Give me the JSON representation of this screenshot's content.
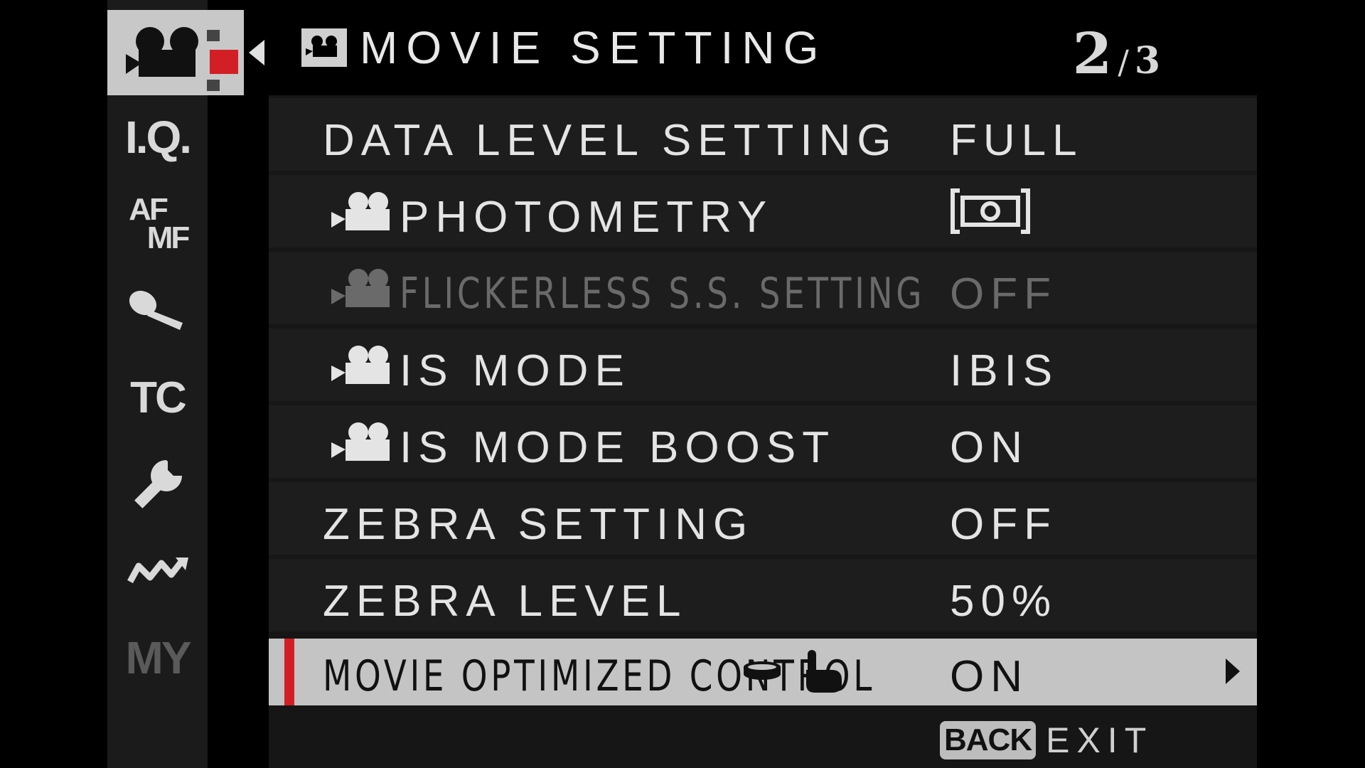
{
  "sidebar": {
    "items": [
      {
        "name": "movie-tab",
        "label": ""
      },
      {
        "name": "image-quality",
        "label": "I.Q."
      },
      {
        "name": "af-mf",
        "label_top": "AF",
        "label_bottom": "MF"
      },
      {
        "name": "audio",
        "icon": "microphone-icon"
      },
      {
        "name": "timecode",
        "label": "TC"
      },
      {
        "name": "setup",
        "icon": "wrench-icon"
      },
      {
        "name": "connection",
        "icon": "wave-arrow-icon"
      },
      {
        "name": "my-menu",
        "label": "MY"
      }
    ]
  },
  "header": {
    "title": "MOVIE SETTING",
    "icon": "movie-camera-icon",
    "page_current": "2",
    "page_separator": "/",
    "page_total": "3"
  },
  "menu": {
    "rows": [
      {
        "label": "DATA LEVEL SETTING",
        "value": "FULL",
        "has_movie_icon": false,
        "enabled": true
      },
      {
        "label": "PHOTOMETRY",
        "value_icon": "photometry-multi-icon",
        "has_movie_icon": true,
        "enabled": true
      },
      {
        "label": "FLICKERLESS S.S. SETTING",
        "value": "OFF",
        "has_movie_icon": true,
        "enabled": false
      },
      {
        "label": "IS MODE",
        "value": "IBIS",
        "has_movie_icon": true,
        "enabled": true
      },
      {
        "label": "IS MODE BOOST",
        "value": "ON",
        "has_movie_icon": true,
        "enabled": true
      },
      {
        "label": "ZEBRA SETTING",
        "value": "OFF",
        "has_movie_icon": false,
        "enabled": true
      },
      {
        "label": "ZEBRA LEVEL",
        "value": "50%",
        "has_movie_icon": false,
        "enabled": true
      },
      {
        "label": "MOVIE OPTIMIZED CONTROL",
        "value": "ON",
        "has_movie_icon": false,
        "enabled": true,
        "selected": true,
        "label_icons": [
          "dial-icon",
          "touch-hand-icon"
        ]
      }
    ]
  },
  "footer": {
    "back_key": "BACK",
    "exit_label": "EXIT"
  },
  "colors": {
    "selection_marker": "#d21f26",
    "selected_row": "#c4c4c4",
    "panel": "#1d1d1d"
  }
}
